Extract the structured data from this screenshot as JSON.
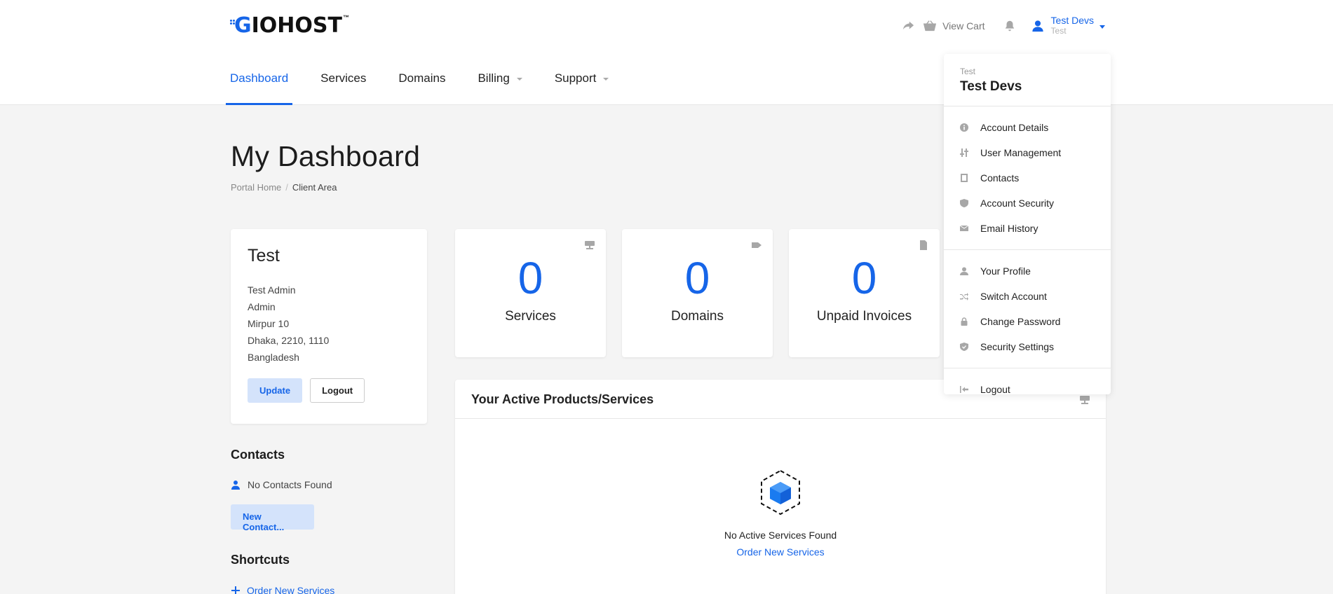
{
  "brand": {
    "logo_text_g": "G",
    "logo_text_rest": "IOHOST",
    "logo_tm": "™"
  },
  "topbar": {
    "cart_label": "View Cart",
    "user_name": "Test Devs",
    "user_company": "Test"
  },
  "nav": {
    "items": [
      {
        "label": "Dashboard",
        "active": true,
        "has_caret": false
      },
      {
        "label": "Services",
        "active": false,
        "has_caret": false
      },
      {
        "label": "Domains",
        "active": false,
        "has_caret": false
      },
      {
        "label": "Billing",
        "active": false,
        "has_caret": true
      },
      {
        "label": "Support",
        "active": false,
        "has_caret": true
      }
    ]
  },
  "page": {
    "title": "My Dashboard",
    "breadcrumb": [
      "Portal Home",
      "Client Area"
    ]
  },
  "profile": {
    "name": "Test",
    "lines": [
      "Test Admin",
      "Admin",
      "Mirpur 10",
      "Dhaka, 2210, 1110",
      "Bangladesh"
    ],
    "update_label": "Update",
    "logout_label": "Logout"
  },
  "contacts": {
    "heading": "Contacts",
    "empty_text": "No Contacts Found",
    "new_button": "New Contact..."
  },
  "shortcuts": {
    "heading": "Shortcuts",
    "first_item": "Order New Services"
  },
  "stats": [
    {
      "value": "0",
      "label": "Services",
      "icon": "server-icon"
    },
    {
      "value": "0",
      "label": "Domains",
      "icon": "tag-icon"
    },
    {
      "value": "0",
      "label": "Unpaid Invoices",
      "icon": "file-icon"
    }
  ],
  "products": {
    "heading": "Your Active Products/Services",
    "empty_text": "No Active Services Found",
    "order_link": "Order New Services"
  },
  "dropdown": {
    "company": "Test",
    "name": "Test Devs",
    "group1": [
      {
        "label": "Account Details",
        "icon": "info-icon"
      },
      {
        "label": "User Management",
        "icon": "sliders-icon"
      },
      {
        "label": "Contacts",
        "icon": "address-book-icon"
      },
      {
        "label": "Account Security",
        "icon": "shield-icon"
      },
      {
        "label": "Email History",
        "icon": "envelope-icon"
      }
    ],
    "group2": [
      {
        "label": "Your Profile",
        "icon": "user-icon"
      },
      {
        "label": "Switch Account",
        "icon": "random-icon"
      },
      {
        "label": "Change Password",
        "icon": "lock-icon"
      },
      {
        "label": "Security Settings",
        "icon": "shield-check-icon"
      }
    ],
    "group3": [
      {
        "label": "Logout",
        "icon": "logout-icon"
      }
    ]
  },
  "colors": {
    "accent": "#1665e8",
    "accent_light": "#d4e3fb",
    "background": "#f4f4f4"
  }
}
